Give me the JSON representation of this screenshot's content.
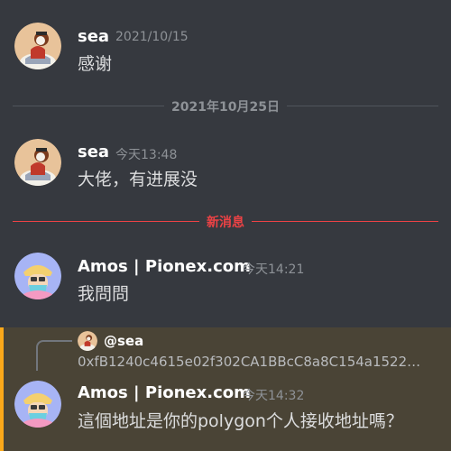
{
  "date_divider": "2021年10月25日",
  "new_divider": "新消息",
  "messages": [
    {
      "username": "sea",
      "timestamp": "2021/10/15",
      "text": "感谢"
    },
    {
      "username": "sea",
      "timestamp": "今天13:48",
      "text": "大佬，有进展没"
    },
    {
      "username": "Amos | Pionex.com",
      "timestamp": "今天14:21",
      "text": "我問問"
    },
    {
      "username": "Amos | Pionex.com",
      "timestamp": "今天14:32",
      "text": "這個地址是你的polygon个人接收地址嗎？"
    }
  ],
  "reply": {
    "mention": "@sea",
    "preview": "0xfB1240c4615e02f302CA1BBcC8a8C154a1522…"
  },
  "colors": {
    "background": "#36393f",
    "highlight": "#4a4436",
    "highlight_bar": "#faa81a",
    "new_divider": "#ed4245"
  },
  "icons": {
    "sea_avatar": "sea-avatar-icon",
    "amos_avatar": "amos-avatar-icon"
  }
}
